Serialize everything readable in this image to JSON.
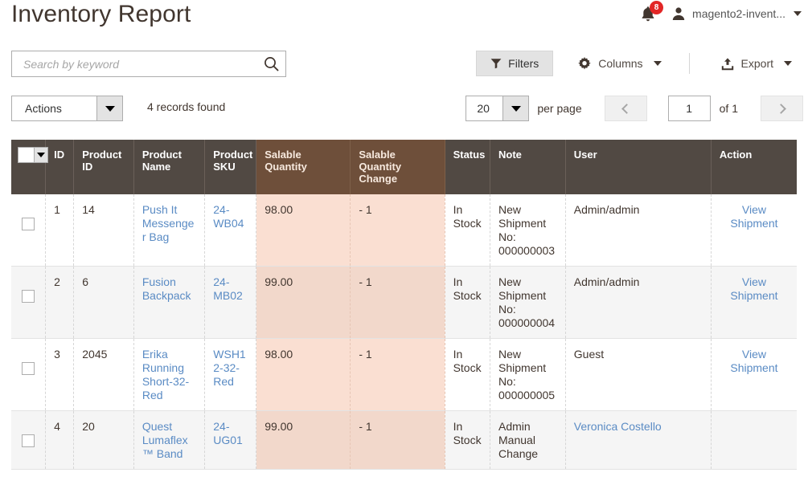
{
  "header": {
    "title": "Inventory Report",
    "notifications": {
      "icon": "bell-icon",
      "count": "8"
    },
    "user": {
      "icon": "user-avatar-icon",
      "name": "magento2-invent..."
    }
  },
  "search": {
    "placeholder": "Search by keyword",
    "value": "",
    "button_icon": "search-icon"
  },
  "toolbar": {
    "filters_label": "Filters",
    "filters_icon": "funnel-icon",
    "columns_label": "Columns",
    "columns_icon": "gear-icon",
    "export_label": "Export",
    "export_icon": "upload-icon"
  },
  "grid_controls": {
    "actions_label": "Actions",
    "records_found": "4 records found",
    "per_page_value": "20",
    "per_page_label": "per page",
    "prev_icon": "chevron-left-icon",
    "next_icon": "chevron-right-icon",
    "page_value": "1",
    "of_label": "of 1"
  },
  "grid": {
    "columns": [
      {
        "key": "check",
        "label": "",
        "highlight": false
      },
      {
        "key": "id",
        "label": "ID",
        "highlight": false
      },
      {
        "key": "pid",
        "label": "Product ID",
        "highlight": false
      },
      {
        "key": "pname",
        "label": "Product Name",
        "highlight": false
      },
      {
        "key": "sku",
        "label": "Product SKU",
        "highlight": false
      },
      {
        "key": "qty",
        "label": "Salable Quantity",
        "highlight": true
      },
      {
        "key": "qchg",
        "label": "Salable Quantity Change",
        "highlight": true
      },
      {
        "key": "status",
        "label": "Status",
        "highlight": false
      },
      {
        "key": "note",
        "label": "Note",
        "highlight": false
      },
      {
        "key": "user",
        "label": "User",
        "highlight": false
      },
      {
        "key": "action",
        "label": "Action",
        "highlight": false
      }
    ],
    "rows": [
      {
        "id": "1",
        "product_id": "14",
        "product_name": "Push It Messenger Bag",
        "product_sku": "24-WB04",
        "salable_quantity": "98.00",
        "salable_quantity_change": "- 1",
        "status": "In Stock",
        "note": "New Shipment No: 000000003",
        "user": "Admin/admin",
        "user_is_link": false,
        "action": "View Shipment"
      },
      {
        "id": "2",
        "product_id": "6",
        "product_name": "Fusion Backpack",
        "product_sku": "24-MB02",
        "salable_quantity": "99.00",
        "salable_quantity_change": "- 1",
        "status": "In Stock",
        "note": "New Shipment No: 000000004",
        "user": "Admin/admin",
        "user_is_link": false,
        "action": "View Shipment"
      },
      {
        "id": "3",
        "product_id": "2045",
        "product_name": "Erika Running Short-32-Red",
        "product_sku": "WSH12-32-Red",
        "salable_quantity": "98.00",
        "salable_quantity_change": "- 1",
        "status": "In Stock",
        "note": "New Shipment No: 000000005",
        "user": "Guest",
        "user_is_link": false,
        "action": "View Shipment"
      },
      {
        "id": "4",
        "product_id": "20",
        "product_name": "Quest Lumaflex™ Band",
        "product_sku": "24-UG01",
        "salable_quantity": "99.00",
        "salable_quantity_change": "- 1",
        "status": "In Stock",
        "note": "Admin Manual Change",
        "user": "Veronica Costello",
        "user_is_link": true,
        "action": ""
      }
    ]
  },
  "colors": {
    "header_bg": "#514943",
    "header_highlight_bg": "#6e4f3a",
    "cell_highlight_bg": "#fadfd2",
    "cell_highlight_striped_bg": "#f2d8cb",
    "link": "#5a8bc4",
    "badge": "#e22626"
  }
}
